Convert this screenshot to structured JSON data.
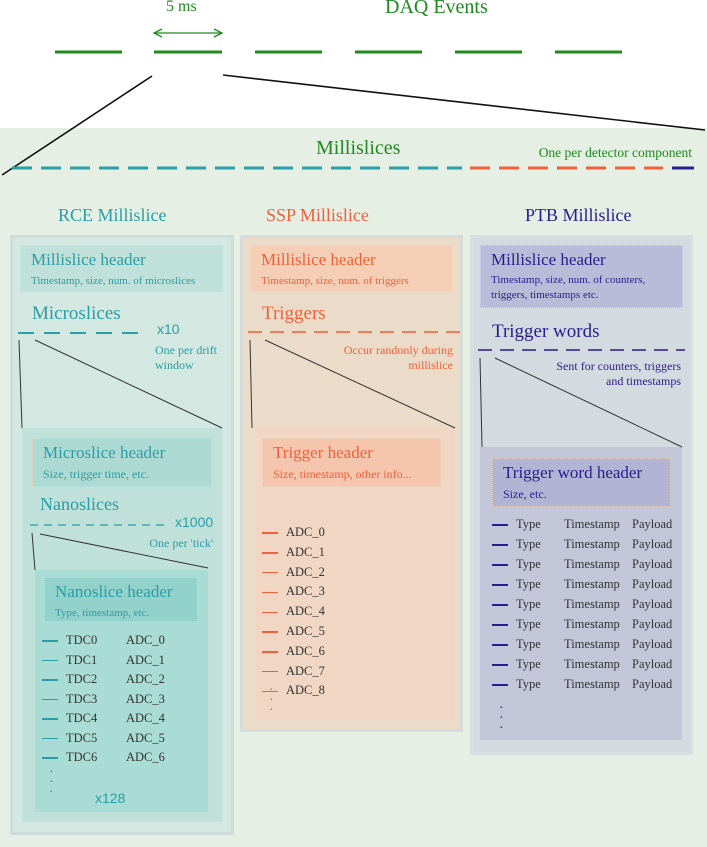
{
  "colors": {
    "green": "#1f8a1f",
    "teal": "#2a9da6",
    "orange": "#f0603a",
    "navy": "#2b1b8e"
  },
  "top": {
    "duration_label": "5 ms",
    "title": "DAQ Events"
  },
  "millislices": {
    "title": "Millislices",
    "note": "One per detector component"
  },
  "rce": {
    "title": "RCE Millislice",
    "header_title": "Millislice header",
    "header_sub": "Timestamp, size, num. of microslices",
    "sub_title": "Microslices",
    "multiplier": "x10",
    "note1": "One per drift",
    "note2": "window",
    "micro_header_title": "Microslice header",
    "micro_header_sub": "Size, trigger time, etc.",
    "nano_title": "Nanoslices",
    "nano_multiplier": "x1000",
    "nano_note": "One per 'tick'",
    "nano_header_title": "Nanoslice header",
    "nano_header_sub": "Type, timestamp, etc.",
    "rows": [
      [
        "TDC0",
        "ADC_0"
      ],
      [
        "TDC1",
        "ADC_1"
      ],
      [
        "TDC2",
        "ADC_2"
      ],
      [
        "TDC3",
        "ADC_3"
      ],
      [
        "TDC4",
        "ADC_4"
      ],
      [
        "TDC5",
        "ADC_5"
      ],
      [
        "TDC6",
        "ADC_6"
      ]
    ],
    "count": "x128"
  },
  "ssp": {
    "title": "SSP Millislice",
    "header_title": "Millislice header",
    "header_sub": "Timestamp, size, num. of triggers",
    "sub_title": "Triggers",
    "note1": "Occur randonly during",
    "note2": "millislice",
    "trig_header_title": "Trigger header",
    "trig_header_sub": "Size, timestamp, other info...",
    "rows": [
      "ADC_0",
      "ADC_1",
      "ADC_2",
      "ADC_3",
      "ADC_4",
      "ADC_5",
      "ADC_6",
      "ADC_7",
      "ADC_8"
    ]
  },
  "ptb": {
    "title": "PTB Millislice",
    "header_title": "Millislice header",
    "header_sub1": "Timestamp, size, num. of counters,",
    "header_sub2": "triggers, timestamps etc.",
    "sub_title": "Trigger words",
    "note1": "Sent for counters, triggers",
    "note2": "and timestamps",
    "word_header_title": "Trigger word header",
    "word_header_sub": "Size, etc.",
    "rows": [
      [
        "Type",
        "Timestamp",
        "Payload"
      ],
      [
        "Type",
        "Timestamp",
        "Payload"
      ],
      [
        "Type",
        "Timestamp",
        "Payload"
      ],
      [
        "Type",
        "Timestamp",
        "Payload"
      ],
      [
        "Type",
        "Timestamp",
        "Payload"
      ],
      [
        "Type",
        "Timestamp",
        "Payload"
      ],
      [
        "Type",
        "Timestamp",
        "Payload"
      ],
      [
        "Type",
        "Timestamp",
        "Payload"
      ],
      [
        "Type",
        "Timestamp",
        "Payload"
      ]
    ]
  }
}
